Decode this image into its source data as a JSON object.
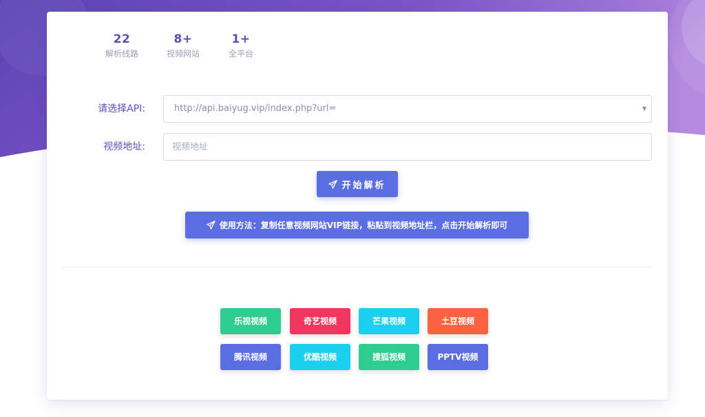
{
  "stats": [
    {
      "value": "22",
      "label": "解析线路"
    },
    {
      "value": "8+",
      "label": "视频网站"
    },
    {
      "value": "1+",
      "label": "全平台"
    }
  ],
  "form": {
    "api_label": "请选择API:",
    "api_selected": "http://api.baiyug.vip/index.php?url=",
    "url_label": "视频地址:",
    "url_placeholder": "视频地址"
  },
  "buttons": {
    "parse_label": "开始解析",
    "howto_label": "使用方法：复制任意视频网站VIP链接，粘贴到视频地址栏，点击开始解析即可"
  },
  "sites": [
    {
      "label": "乐视视频",
      "color": "#2ecc8f"
    },
    {
      "label": "奇艺视频",
      "color": "#f0365d"
    },
    {
      "label": "芒果视频",
      "color": "#1ccfef"
    },
    {
      "label": "土豆视频",
      "color": "#fb6340"
    },
    {
      "label": "腾讯视频",
      "color": "#5b6ee1"
    },
    {
      "label": "优酷视频",
      "color": "#1ccfef"
    },
    {
      "label": "搜狐视频",
      "color": "#2ecc8f"
    },
    {
      "label": "PPTV视频",
      "color": "#5b6ee1"
    }
  ],
  "colors": {
    "accent": "#5b6ee1",
    "label_text": "#5a4fbd",
    "header_gradient_start": "#6a4ac0",
    "header_gradient_end": "#a779d6"
  },
  "icons": {
    "parse_button_icon": "paper-plane-icon",
    "howto_button_icon": "paper-plane-icon"
  }
}
